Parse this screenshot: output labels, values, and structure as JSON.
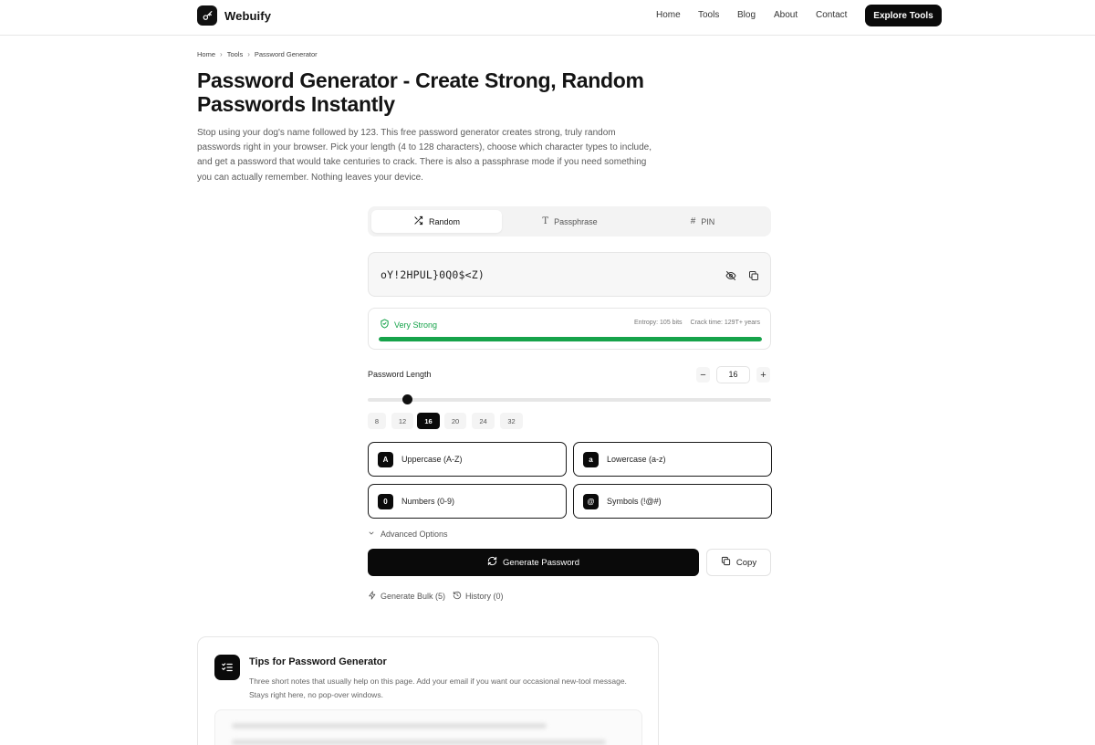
{
  "header": {
    "brand": "Webuify",
    "nav": [
      "Home",
      "Tools",
      "Blog",
      "About",
      "Contact"
    ],
    "cta": "Explore Tools"
  },
  "breadcrumb": [
    "Home",
    "Tools",
    "Password Generator"
  ],
  "page": {
    "title": "Password Generator - Create Strong, Random Passwords Instantly",
    "intro": "Stop using your dog's name followed by 123. This free password generator creates strong, truly random passwords right in your browser. Pick your length (4 to 128 characters), choose which character types to include, and get a password that would take centuries to crack. There is also a passphrase mode if you need something you can actually remember. Nothing leaves your device."
  },
  "tabs": [
    {
      "label": "Random",
      "icon": "shuffle-icon",
      "active": true
    },
    {
      "label": "Passphrase",
      "icon": "text-icon",
      "active": false
    },
    {
      "label": "PIN",
      "icon": "hash-icon",
      "active": false
    }
  ],
  "password": {
    "value": "oY!2HPUL}0Q0$<Z)"
  },
  "strength": {
    "label": "Very Strong",
    "entropy": "Entropy: 105 bits",
    "crack_time": "Crack time: 129T+ years",
    "level": 1.0,
    "color": "#16a34a"
  },
  "length": {
    "label": "Password Length",
    "value": "16",
    "min": 4,
    "max": 128,
    "presets": [
      "8",
      "12",
      "16",
      "20",
      "24",
      "32"
    ],
    "active_preset": "16"
  },
  "options": [
    {
      "badge": "A",
      "label": "Uppercase (A-Z)"
    },
    {
      "badge": "a",
      "label": "Lowercase (a-z)"
    },
    {
      "badge": "0",
      "label": "Numbers (0-9)"
    },
    {
      "badge": "@",
      "label": "Symbols (!@#)"
    }
  ],
  "advanced_label": "Advanced Options",
  "actions": {
    "generate": "Generate Password",
    "copy": "Copy",
    "bulk": "Generate Bulk (5)",
    "history": "History (0)"
  },
  "tips": {
    "title": "Tips for Password Generator",
    "description": "Three short notes that usually help on this page. Add your email if you want our occasional new-tool message. Stays right here, no pop-over windows."
  },
  "colors": {
    "accent": "#0a0a0a",
    "success": "#16a34a"
  }
}
